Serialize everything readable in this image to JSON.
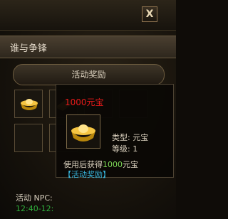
{
  "window": {
    "close_label": "X"
  },
  "section": {
    "title": "谁与争锋"
  },
  "reward": {
    "header": "活动奖励"
  },
  "tooltip": {
    "item_name": "1000元宝",
    "type_line": "类型: 元宝",
    "level_line": "等级: 1",
    "use_prefix": "使用后获得",
    "use_amount": "1000",
    "use_suffix": "元宝",
    "link_text": "【活动奖励】"
  },
  "background_text": {
    "npc_line": "活动 NPC:",
    "time_line": "12:40-12:"
  },
  "colors": {
    "title_red": "#e61a1a",
    "amount_green": "#7ed957",
    "link_blue": "#38b8e0",
    "time_green": "#2fae3c"
  },
  "icons": {
    "item": "gold-ingot-icon",
    "close": "close-icon"
  }
}
